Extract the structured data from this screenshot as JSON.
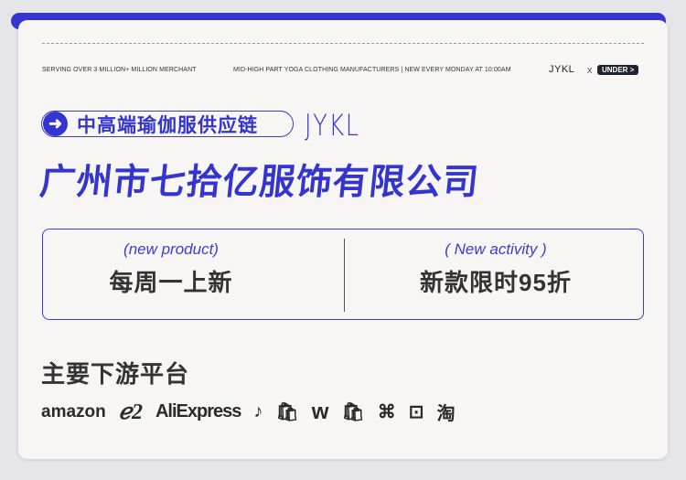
{
  "header": {
    "left": "SERVING OVER 3 MILLION+  MILLION MERCHANT",
    "middle": "MID-HIGH PART YOGA CLOTHING MANUFACTURERS  | NEW EVERY MONDAY AT 10:00AM",
    "brand": "JYKL",
    "x": "X",
    "badge": "UNDER >"
  },
  "pill": {
    "text": "中高端瑜伽服供应链",
    "icon": "arrow-right-icon"
  },
  "logo_text": "JYKL",
  "title": "广州市七拾亿服饰有限公司",
  "features": [
    {
      "sub": "(new product)",
      "main": "每周一上新"
    },
    {
      "sub": "( New activity )",
      "main": "新款限时95折"
    }
  ],
  "platforms": {
    "heading": "主要下游平台",
    "items": [
      "amazon",
      "alibaba",
      "AliExpress",
      "tiktok",
      "shopee",
      "wish",
      "shopify",
      "kuaishou",
      "tmall",
      "淘"
    ]
  },
  "colors": {
    "accent": "#3434d0",
    "text": "#333333"
  }
}
